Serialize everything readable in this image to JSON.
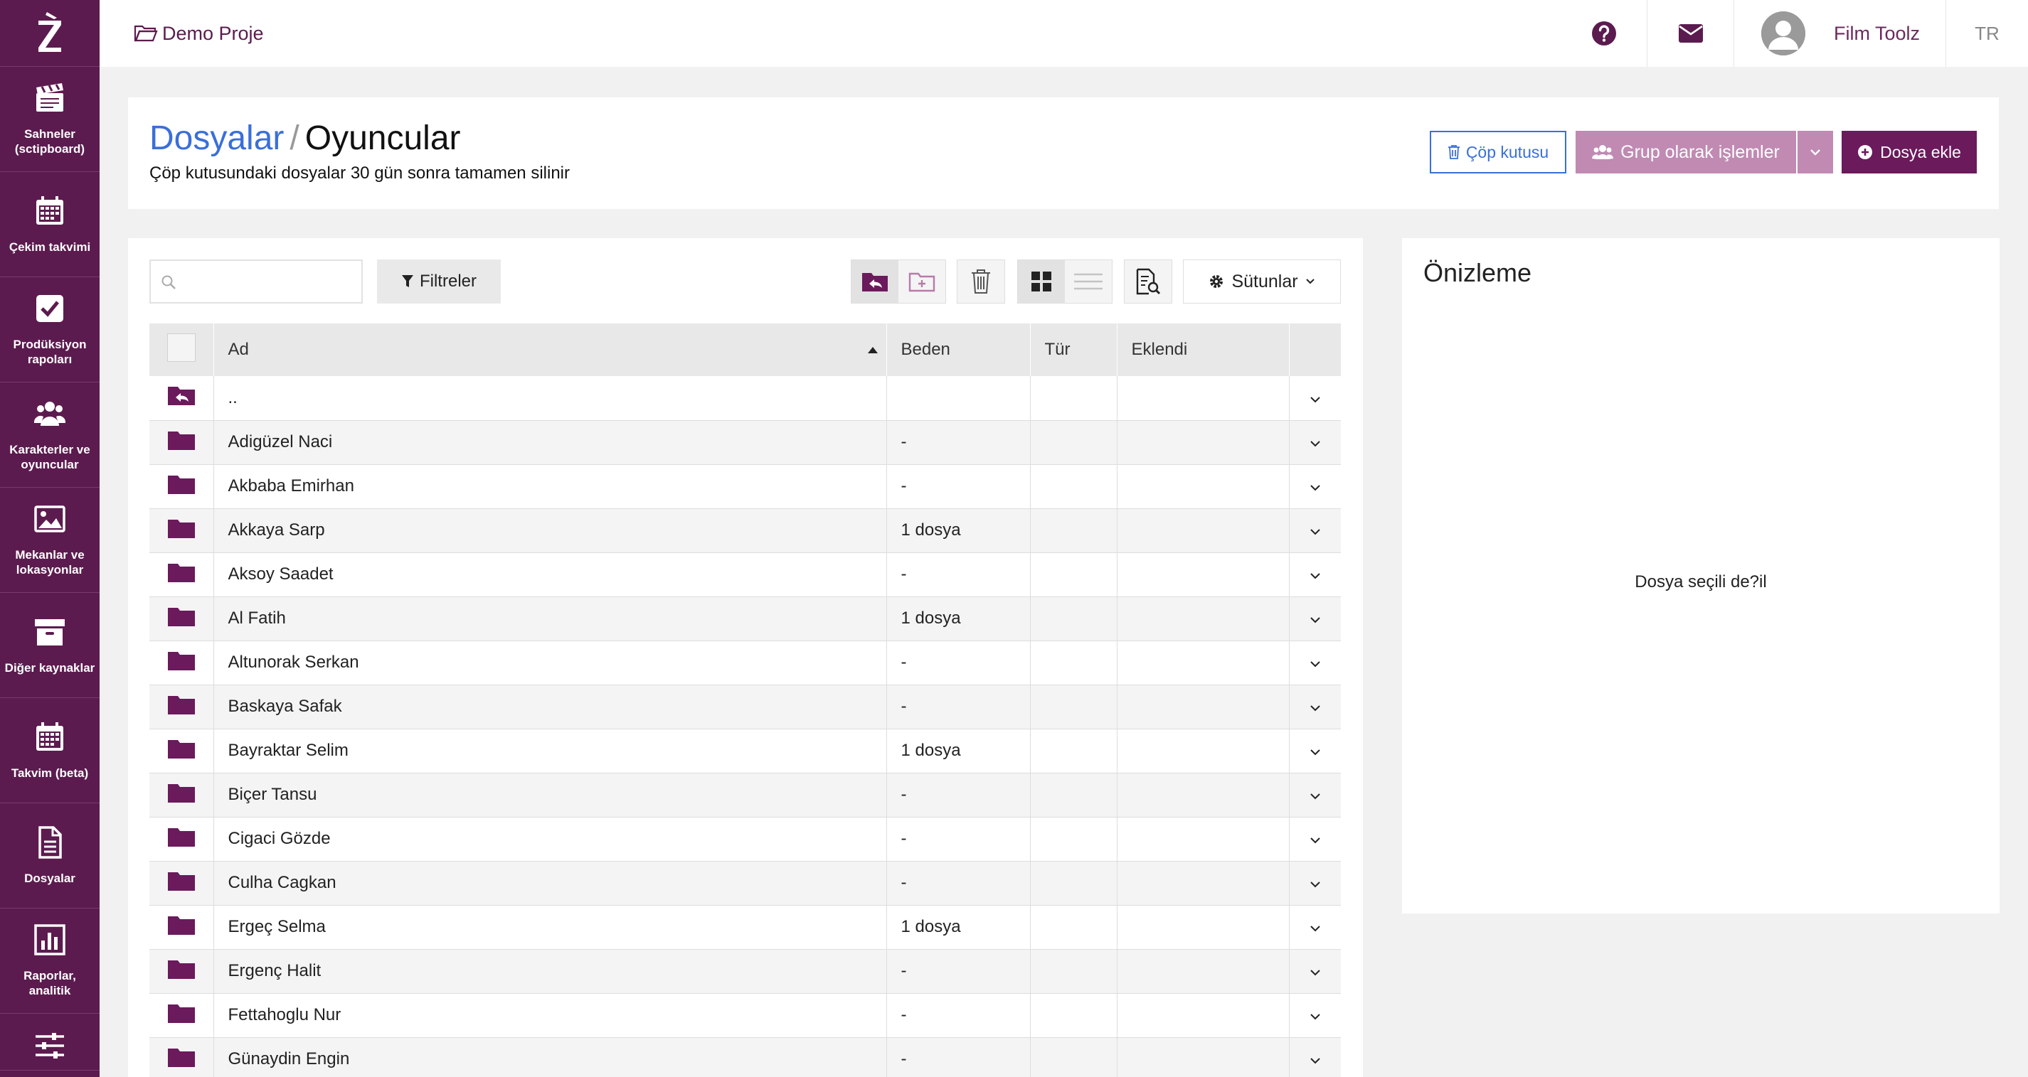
{
  "topbar": {
    "project": "Demo Proje",
    "user_name": "Film Toolz",
    "lang": "TR"
  },
  "sidebar": {
    "items": [
      {
        "label": "Sahneler (sctipboard)",
        "icon": "clapperboard-icon"
      },
      {
        "label": "Çekim takvimi",
        "icon": "calendar-icon"
      },
      {
        "label": "Prodüksiyon rapoları",
        "icon": "checkbox-icon"
      },
      {
        "label": "Karakterler ve oyuncular",
        "icon": "users-icon"
      },
      {
        "label": "Mekanlar ve lokasyonlar",
        "icon": "image-icon"
      },
      {
        "label": "Diğer kaynaklar",
        "icon": "archive-icon"
      },
      {
        "label": "Takvim (beta)",
        "icon": "calendar-icon"
      },
      {
        "label": "Dosyalar",
        "icon": "file-icon"
      },
      {
        "label": "Raporlar, analitik",
        "icon": "bar-chart-icon"
      },
      {
        "label": "",
        "icon": "sliders-icon"
      }
    ]
  },
  "header": {
    "crumb_root": "Dosyalar",
    "crumb_sep": "/",
    "crumb_current": "Oyuncular",
    "subtitle": "Çöp kutusundaki dosyalar 30 gün sonra tamamen silinir",
    "trash_label": "Çöp kutusu",
    "group_label": "Grup olarak işlemler",
    "add_label": "Dosya ekle"
  },
  "toolbar": {
    "search_placeholder": "",
    "filter_label": "Filtreler",
    "columns_label": "Sütunlar"
  },
  "table": {
    "headers": {
      "name": "Ad",
      "size": "Beden",
      "type": "Tür",
      "added": "Eklendi"
    },
    "up_row": "..",
    "rows": [
      {
        "name": "Adigüzel Naci",
        "size": "-"
      },
      {
        "name": "Akbaba Emirhan",
        "size": "-"
      },
      {
        "name": "Akkaya Sarp",
        "size": "1 dosya"
      },
      {
        "name": "Aksoy Saadet",
        "size": "-"
      },
      {
        "name": "Al Fatih",
        "size": "1 dosya"
      },
      {
        "name": "Altunorak Serkan",
        "size": "-"
      },
      {
        "name": "Baskaya Safak",
        "size": "-"
      },
      {
        "name": "Bayraktar Selim",
        "size": "1 dosya"
      },
      {
        "name": "Biçer Tansu",
        "size": "-"
      },
      {
        "name": "Cigaci Gözde",
        "size": "-"
      },
      {
        "name": "Culha Cagkan",
        "size": "-"
      },
      {
        "name": "Ergeç Selma",
        "size": "1 dosya"
      },
      {
        "name": "Ergenç Halit",
        "size": "-"
      },
      {
        "name": "Fettahoglu Nur",
        "size": "-"
      },
      {
        "name": "Günaydin Engin",
        "size": "-"
      }
    ]
  },
  "preview": {
    "title": "Önizleme",
    "empty_text": "Dosya seçili de?il"
  },
  "colors": {
    "brand": "#5c1b4f",
    "accent_blue": "#3a6fd8",
    "button_muted": "#c08ab3",
    "folder": "#6b1a5c"
  }
}
